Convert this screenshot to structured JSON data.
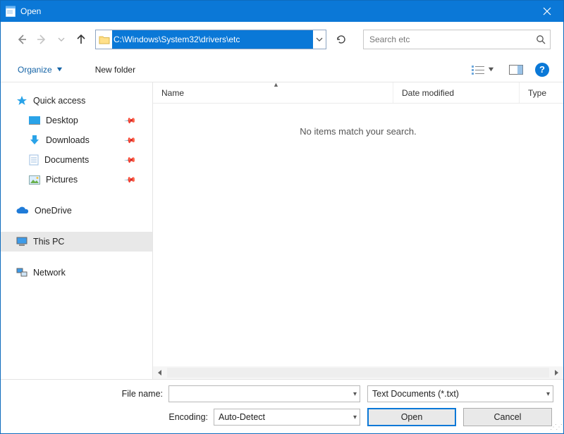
{
  "titlebar": {
    "title": "Open"
  },
  "address": {
    "path": "C:\\Windows\\System32\\drivers\\etc"
  },
  "search": {
    "placeholder": "Search etc"
  },
  "toolbar": {
    "organize": "Organize",
    "newfolder": "New folder"
  },
  "sidebar": {
    "quick_access": "Quick access",
    "desktop": "Desktop",
    "downloads": "Downloads",
    "documents": "Documents",
    "pictures": "Pictures",
    "onedrive": "OneDrive",
    "this_pc": "This PC",
    "network": "Network"
  },
  "columns": {
    "name": "Name",
    "date": "Date modified",
    "type": "Type"
  },
  "content": {
    "empty_message": "No items match your search."
  },
  "bottom": {
    "filename_label": "File name:",
    "filename_value": "",
    "filter_value": "Text Documents (*.txt)",
    "encoding_label": "Encoding:",
    "encoding_value": "Auto-Detect",
    "open": "Open",
    "cancel": "Cancel"
  }
}
